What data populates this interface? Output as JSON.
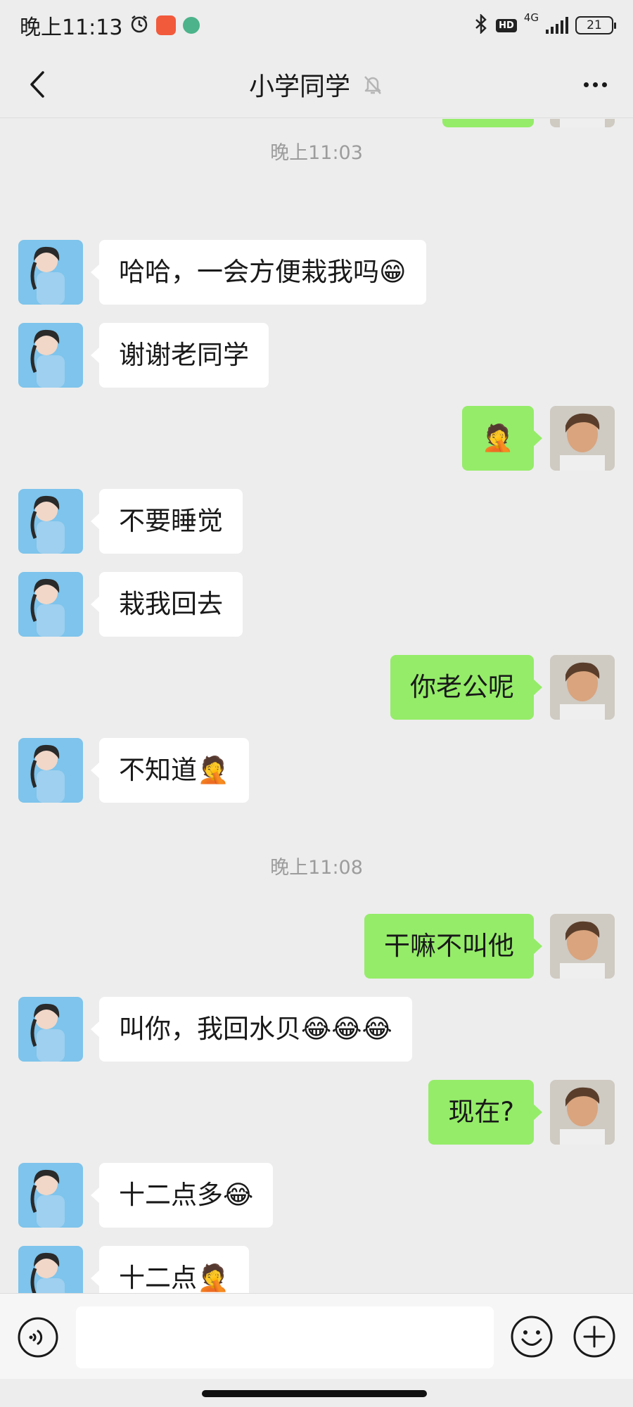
{
  "status_bar": {
    "time": "晚上11:13",
    "network": "4G",
    "hd_label": "HD",
    "battery": "21"
  },
  "nav": {
    "title": "小学同学"
  },
  "timestamps": [
    "晚上11:03",
    "晚上11:08"
  ],
  "messages": [
    {
      "side": "left",
      "text": "哈哈，一会方便栽我吗😁"
    },
    {
      "side": "left",
      "text": "谢谢老同学"
    },
    {
      "side": "right",
      "text": "🤦"
    },
    {
      "side": "left",
      "text": "不要睡觉"
    },
    {
      "side": "left",
      "text": "栽我回去"
    },
    {
      "side": "right",
      "text": "你老公呢"
    },
    {
      "side": "left",
      "text": "不知道🤦"
    },
    {
      "side": "right",
      "text": "干嘛不叫他"
    },
    {
      "side": "left",
      "text": "叫你，我回水贝😂😂😂"
    },
    {
      "side": "right",
      "text": "现在?"
    },
    {
      "side": "left",
      "text": "十二点多😂"
    },
    {
      "side": "left",
      "text": "十二点🤦"
    }
  ],
  "input": {
    "value": ""
  },
  "icons": {
    "back": "chevron-left-icon",
    "mute": "bell-off-icon",
    "more": "more-dots-icon",
    "voice": "voice-icon",
    "emoji": "smiley-icon",
    "plus": "plus-circle-icon"
  },
  "colors": {
    "background": "#ededed",
    "bubble_self": "#95ec69",
    "bubble_other": "#ffffff",
    "timestamp": "#9c9c9c"
  }
}
